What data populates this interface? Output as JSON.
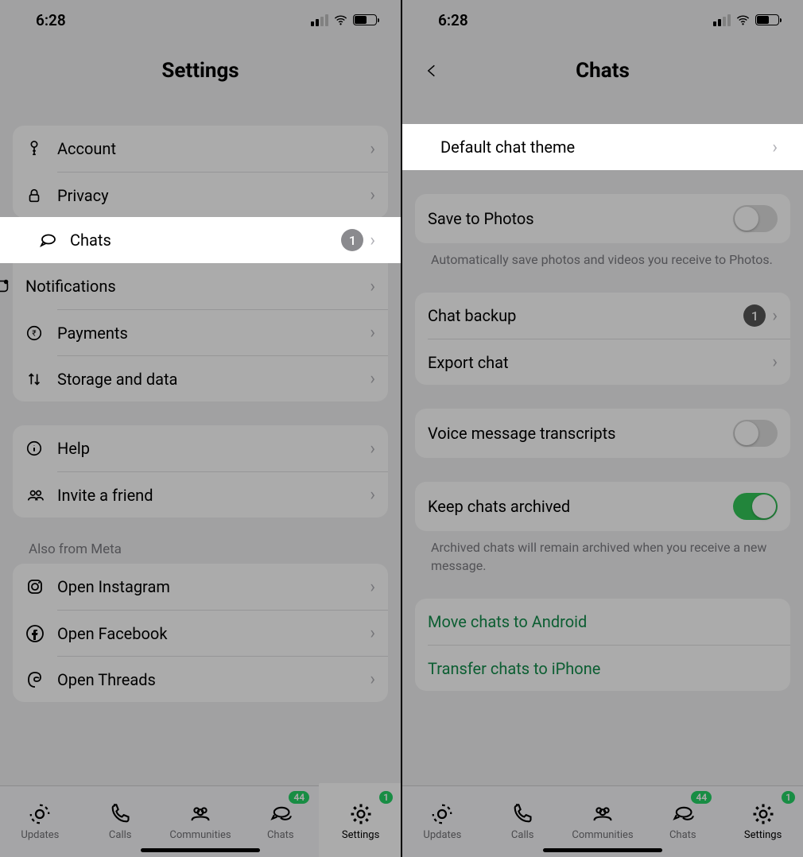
{
  "status": {
    "time": "6:28"
  },
  "left": {
    "title": "Settings",
    "rows": {
      "account": "Account",
      "privacy": "Privacy",
      "chats": "Chats",
      "chats_badge": "1",
      "notifications": "Notifications",
      "payments": "Payments",
      "storage": "Storage and data",
      "help": "Help",
      "invite": "Invite a friend"
    },
    "meta_section": "Also from Meta",
    "meta": {
      "instagram": "Open Instagram",
      "facebook": "Open Facebook",
      "threads": "Open Threads"
    }
  },
  "right": {
    "title": "Chats",
    "default_theme": "Default chat theme",
    "save_photos": "Save to Photos",
    "save_caption": "Automatically save photos and videos you receive to Photos.",
    "backup": "Chat backup",
    "backup_badge": "1",
    "export": "Export chat",
    "voice": "Voice message transcripts",
    "archived": "Keep chats archived",
    "archived_caption": "Archived chats will remain archived when you receive a new message.",
    "move_android": "Move chats to Android",
    "transfer_iphone": "Transfer chats to iPhone"
  },
  "tabs": {
    "updates": "Updates",
    "calls": "Calls",
    "communities": "Communities",
    "chats": "Chats",
    "chats_badge": "44",
    "settings": "Settings",
    "settings_badge": "1"
  }
}
